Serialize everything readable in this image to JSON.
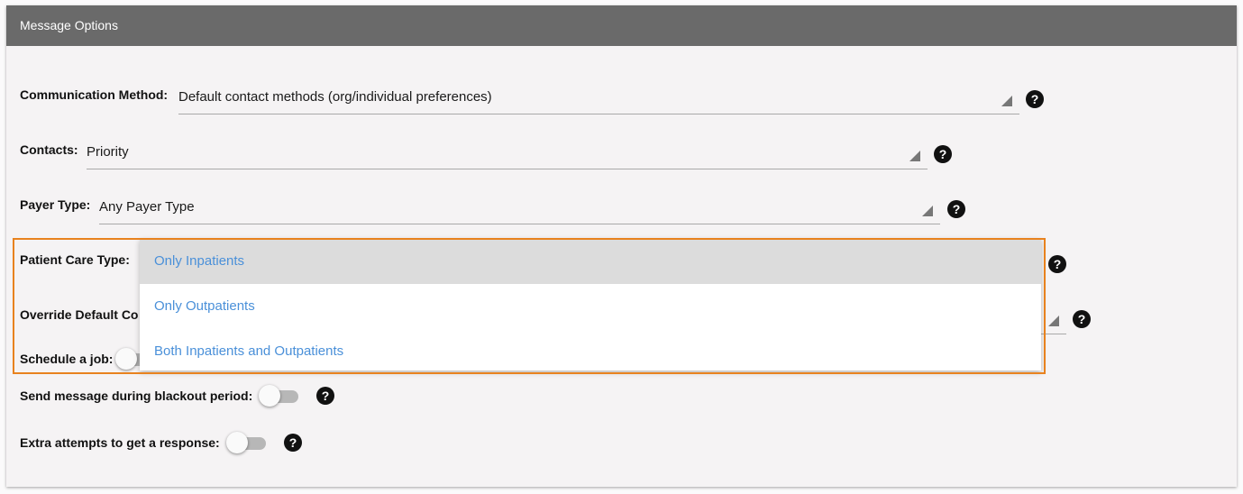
{
  "panel": {
    "title": "Message Options"
  },
  "fields": {
    "communication_method": {
      "label": "Communication Method:",
      "value": "Default contact methods (org/individual preferences)"
    },
    "contacts": {
      "label": "Contacts:",
      "value": "Priority"
    },
    "payer_type": {
      "label": "Payer Type:",
      "value": "Any Payer Type"
    },
    "patient_care_type": {
      "label": "Patient Care Type:",
      "options": [
        "Only Inpatients",
        "Only Outpatients",
        "Both Inpatients and Outpatients"
      ],
      "highlighted_option": "Only Inpatients"
    },
    "override_default": {
      "label": "Override Default Co"
    },
    "schedule_job": {
      "label": "Schedule a job:",
      "enabled": false
    },
    "blackout": {
      "label": "Send message during blackout period:",
      "enabled": false
    },
    "extra_attempts": {
      "label": "Extra attempts to get a response:",
      "enabled": false
    }
  },
  "icons": {
    "help": "help-circle-icon",
    "dropdown_arrow": "triangle-down-icon"
  },
  "help_glyph": "?",
  "colors": {
    "header_bg": "#6a6a6a",
    "option_text": "#4a90d9",
    "highlight_border": "#e8821e",
    "selected_option_bg": "#dcdcdc"
  }
}
